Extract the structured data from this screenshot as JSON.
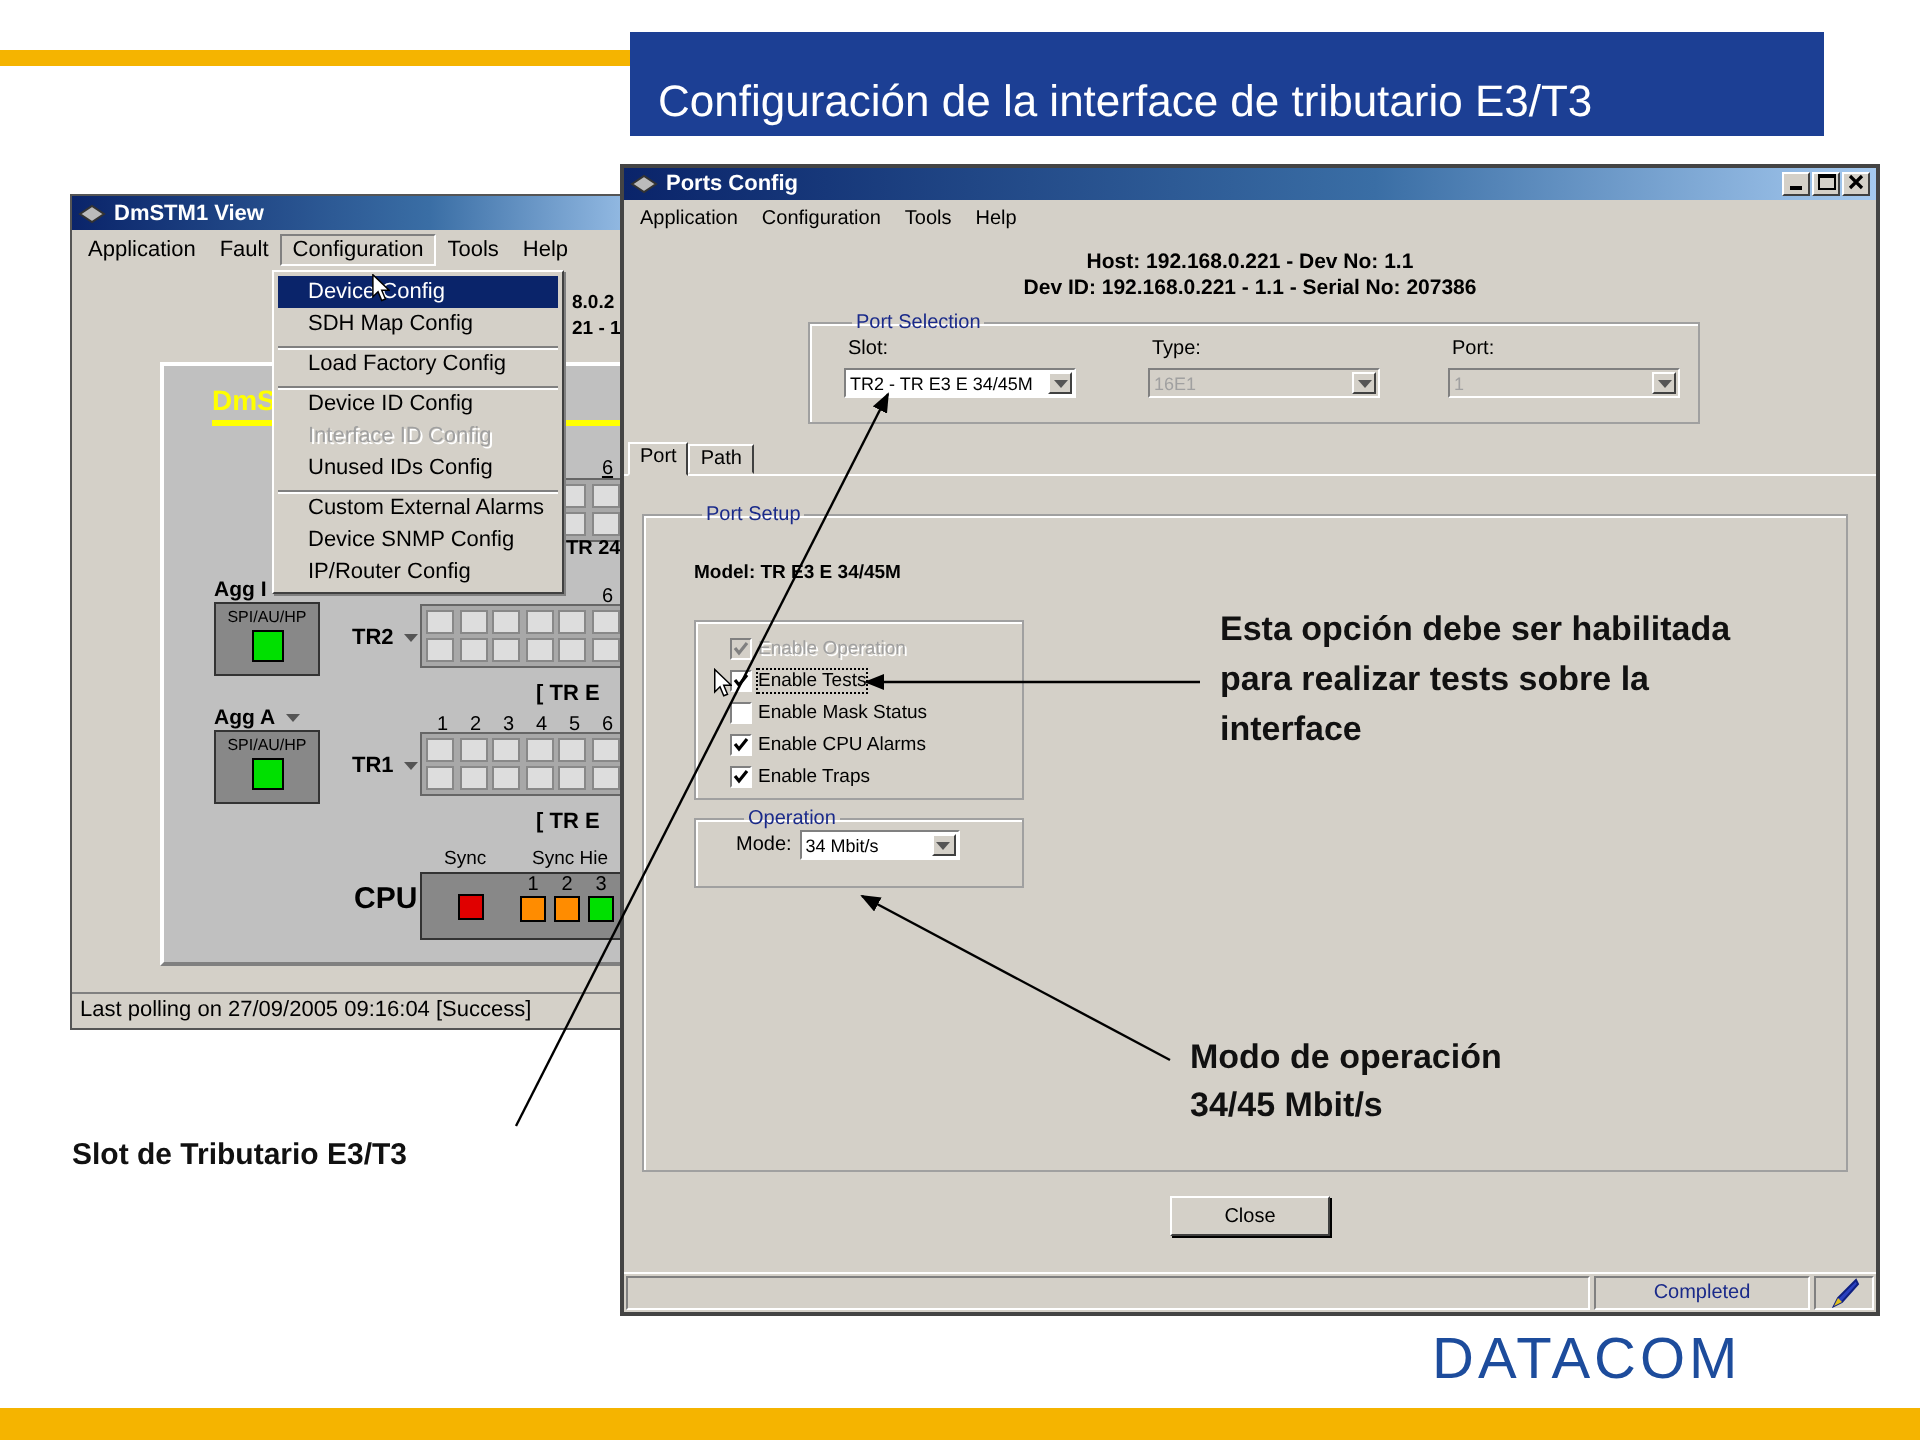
{
  "slide_title": "Configuración de la interface de tributario E3/T3",
  "logo": "DATACOM",
  "dmstm1_window": {
    "title": "DmSTM1 View",
    "menu": [
      {
        "label": "Application",
        "selected": false
      },
      {
        "label": "Fault",
        "selected": false
      },
      {
        "label": "Configuration",
        "selected": true
      },
      {
        "label": "Tools",
        "selected": false
      },
      {
        "label": "Help",
        "selected": false
      }
    ],
    "header_lines": [
      "8.0.2",
      "21 - 1"
    ],
    "device_name": "DmS",
    "upper_tributary": {
      "numbers": [
        "6"
      ],
      "caption": "TR 24"
    },
    "tributaries": [
      {
        "aggregate": {
          "label": "Agg I",
          "arrow_shown": false,
          "interface": "SPI/AU/HP",
          "color": "#00e000"
        },
        "label": "TR2",
        "numbers": [
          "6"
        ],
        "caption": "[ TR E"
      },
      {
        "aggregate": {
          "label": "Agg A",
          "arrow_shown": true,
          "interface": "SPI/AU/HP",
          "color": "#00e000"
        },
        "label": "TR1",
        "numbers": [
          "1",
          "2",
          "3",
          "4",
          "5",
          "6"
        ],
        "caption": "[ TR E"
      }
    ],
    "cpu": {
      "label": "CPU",
      "sync": {
        "label": "Sync",
        "color": "#e00000"
      },
      "sync_hier_label": "Sync Hie",
      "leds": [
        {
          "number": "1",
          "color": "#ff8c00"
        },
        {
          "number": "2",
          "color": "#ff8c00"
        },
        {
          "number": "3",
          "color": "#00e000"
        }
      ]
    },
    "menu_dropdown": [
      {
        "label": "Device Config",
        "selected": true,
        "disabled": false,
        "separator_before": false
      },
      {
        "label": "SDH Map Config",
        "selected": false,
        "disabled": false,
        "separator_before": false
      },
      {
        "label": "Load Factory Config",
        "selected": false,
        "disabled": false,
        "separator_before": true
      },
      {
        "label": "Device ID Config",
        "selected": false,
        "disabled": false,
        "separator_before": true
      },
      {
        "label": "Interface ID Config",
        "selected": false,
        "disabled": true,
        "separator_before": false
      },
      {
        "label": "Unused IDs Config",
        "selected": false,
        "disabled": false,
        "separator_before": false
      },
      {
        "label": "Custom External Alarms",
        "selected": false,
        "disabled": false,
        "separator_before": true
      },
      {
        "label": "Device SNMP Config",
        "selected": false,
        "disabled": false,
        "separator_before": false
      },
      {
        "label": "IP/Router Config",
        "selected": false,
        "disabled": false,
        "separator_before": false
      }
    ],
    "status": "Last polling on 27/09/2005 09:16:04 [Success]"
  },
  "ports_config_window": {
    "title": "Ports Config",
    "menu": [
      "Application",
      "Configuration",
      "Tools",
      "Help"
    ],
    "header_lines": [
      "Host: 192.168.0.221 - Dev No: 1.1",
      "Dev ID: 192.168.0.221 - 1.1 - Serial No: 207386"
    ],
    "port_selection": {
      "title": "Port Selection",
      "fields": [
        {
          "label": "Slot:",
          "value": "TR2 - TR E3 E 34/45M",
          "disabled": false
        },
        {
          "label": "Type:",
          "value": "16E1",
          "disabled": true
        },
        {
          "label": "Port:",
          "value": "1",
          "disabled": true
        }
      ]
    },
    "tabs": [
      {
        "label": "Port",
        "selected": true
      },
      {
        "label": "Path",
        "selected": false
      }
    ],
    "port_setup": {
      "title": "Port Setup",
      "model": "Model: TR E3 E 34/45M",
      "options": [
        {
          "label": "Enable Operation",
          "checked": true,
          "disabled": true
        },
        {
          "label": "Enable Tests",
          "checked": true,
          "disabled": false
        },
        {
          "label": "Enable Mask Status",
          "checked": false,
          "disabled": false
        },
        {
          "label": "Enable CPU Alarms",
          "checked": true,
          "disabled": false
        },
        {
          "label": "Enable Traps",
          "checked": true,
          "disabled": false
        }
      ],
      "operation": {
        "title": "Operation",
        "mode_label": "Mode:",
        "mode_value": "34 Mbit/s"
      }
    },
    "close_button": "Close",
    "status": "Completed"
  },
  "callouts": [
    {
      "lines": [
        "Esta opción debe ser habilitada",
        "para realizar tests sobre la",
        "interface"
      ]
    },
    {
      "lines": [
        "Modo de operación",
        "34/45 Mbit/s"
      ]
    },
    {
      "lines": [
        "Slot de Tributario E3/T3"
      ]
    }
  ]
}
